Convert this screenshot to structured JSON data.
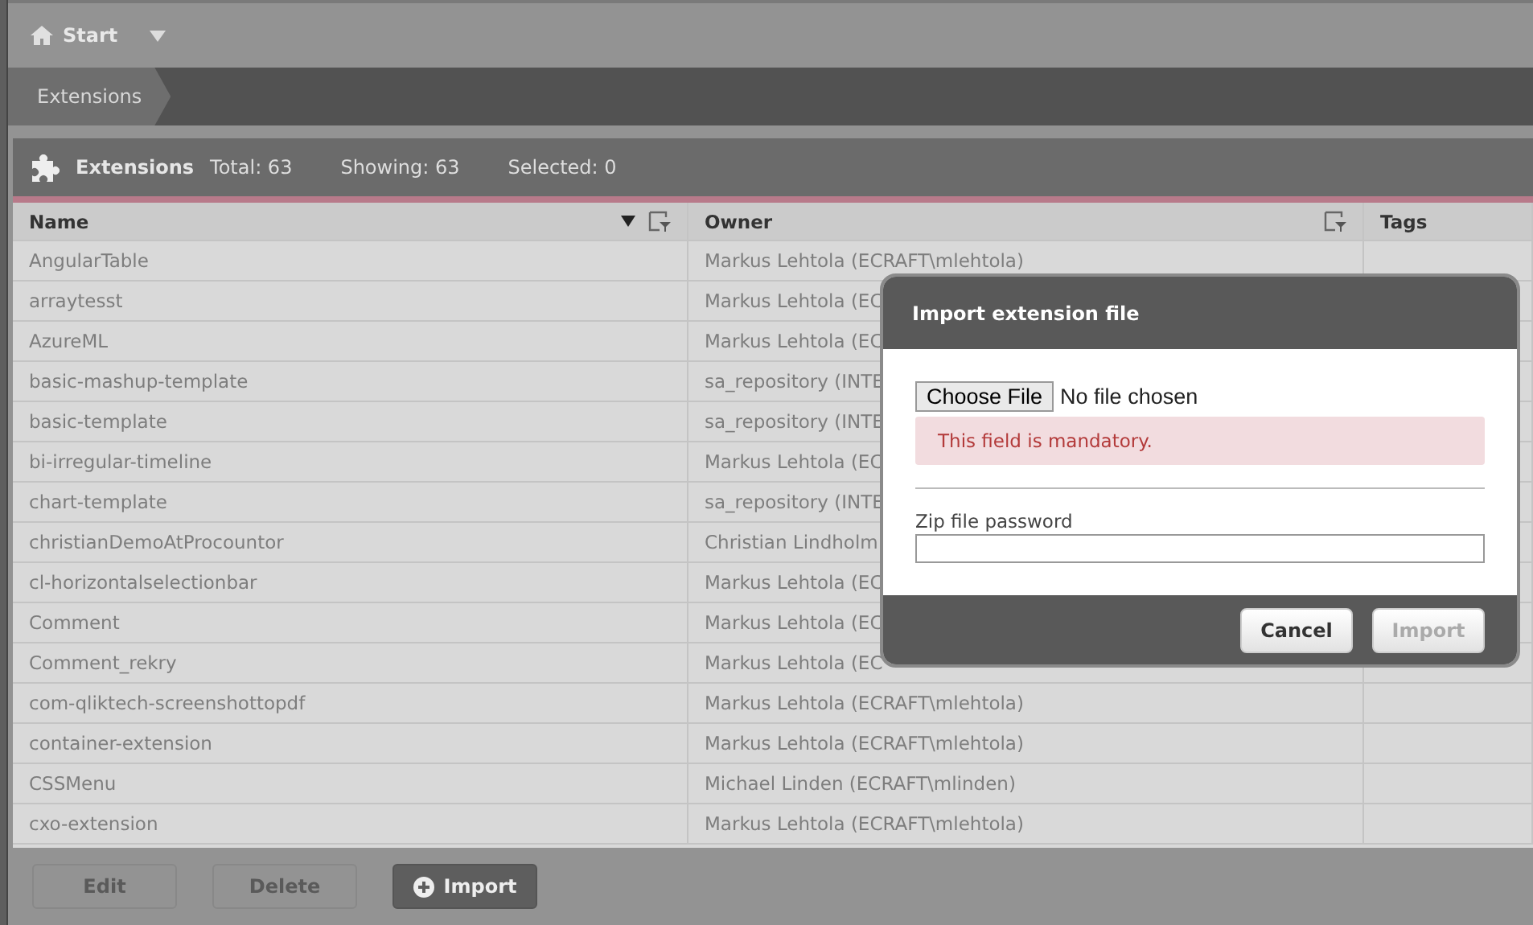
{
  "top_bar": {
    "title": "Start"
  },
  "breadcrumb": {
    "items": [
      {
        "label": "Extensions",
        "selected": true
      }
    ]
  },
  "panel": {
    "title": "Extensions",
    "stats": [
      "Total: 63",
      "Showing: 63",
      "Selected: 0"
    ]
  },
  "table": {
    "columns": [
      {
        "label": "Name",
        "sorted": true,
        "filter": true
      },
      {
        "label": "Owner",
        "sorted": false,
        "filter": true
      },
      {
        "label": "Tags",
        "sorted": false,
        "filter": false
      }
    ],
    "rows": [
      [
        "AngularTable",
        "Markus Lehtola (ECRAFT\\mlehtola)",
        ""
      ],
      [
        "arraytesst",
        "Markus Lehtola (EC",
        ""
      ],
      [
        "AzureML",
        "Markus Lehtola (EC",
        ""
      ],
      [
        "basic-mashup-template",
        "sa_repository (INTE",
        ""
      ],
      [
        "basic-template",
        "sa_repository (INTE",
        ""
      ],
      [
        "bi-irregular-timeline",
        "Markus Lehtola (EC",
        ""
      ],
      [
        "chart-template",
        "sa_repository (INTE",
        ""
      ],
      [
        "christianDemoAtProcountor",
        "Christian Lindholm",
        ""
      ],
      [
        "cl-horizontalselectionbar",
        "Markus Lehtola (EC",
        ""
      ],
      [
        "Comment",
        "Markus Lehtola (EC",
        ""
      ],
      [
        "Comment_rekry",
        "Markus Lehtola (EC",
        ""
      ],
      [
        "com-qliktech-screenshottopdf",
        "Markus Lehtola (ECRAFT\\mlehtola)",
        ""
      ],
      [
        "container-extension",
        "Markus Lehtola (ECRAFT\\mlehtola)",
        ""
      ],
      [
        "CSSMenu",
        "Michael Linden (ECRAFT\\mlinden)",
        ""
      ],
      [
        "cxo-extension",
        "Markus Lehtola (ECRAFT\\mlehtola)",
        ""
      ]
    ]
  },
  "footer": {
    "buttons": [
      {
        "label": "Edit",
        "disabled": true,
        "kind": "plain"
      },
      {
        "label": "Delete",
        "disabled": true,
        "kind": "plain"
      },
      {
        "label": "Import",
        "disabled": false,
        "kind": "add"
      }
    ]
  },
  "dialog": {
    "title": "Import extension file",
    "file_button": "Choose File",
    "file_status": "No file chosen",
    "error": "This field is mandatory.",
    "password_label": "Zip file password",
    "buttons": [
      {
        "label": "Cancel",
        "disabled": false
      },
      {
        "label": "Import",
        "disabled": true
      }
    ]
  }
}
